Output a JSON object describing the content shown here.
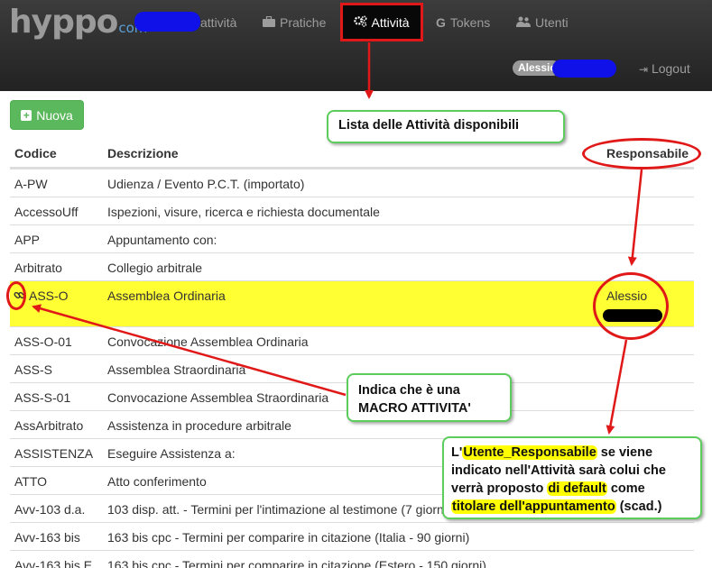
{
  "navbar": {
    "logo_main": "hyppo",
    "logo_suffix": "com",
    "items": [
      {
        "label": "attività",
        "icon": "none"
      },
      {
        "label": "Pratiche",
        "icon": "briefcase-icon"
      },
      {
        "label": "Attività",
        "icon": "gears-icon",
        "active": true
      },
      {
        "label": "Tokens",
        "icon": "google-icon"
      },
      {
        "label": "Utenti",
        "icon": "users-icon"
      }
    ],
    "user": "Alessio",
    "logout_label": "Logout"
  },
  "toolbar": {
    "new_label": "Nuova"
  },
  "table": {
    "headers": {
      "code": "Codice",
      "description": "Descrizione",
      "responsible": "Responsabile"
    },
    "rows": [
      {
        "code": "A-PW",
        "description": "Udienza / Evento P.C.T. (importato)",
        "responsible": ""
      },
      {
        "code": "AccessoUff",
        "description": "Ispezioni, visure, ricerca e richiesta documentale",
        "responsible": ""
      },
      {
        "code": "APP",
        "description": "Appuntamento con:",
        "responsible": ""
      },
      {
        "code": "Arbitrato",
        "description": "Collegio arbitrale",
        "responsible": ""
      },
      {
        "code": "ASS-O",
        "description": "Assemblea Ordinaria",
        "responsible": "Alessio",
        "macro": true,
        "highlighted": true
      },
      {
        "code": "ASS-O-01",
        "description": "Convocazione Assemblea Ordinaria",
        "responsible": ""
      },
      {
        "code": "ASS-S",
        "description": "Assemblea Straordinaria",
        "responsible": ""
      },
      {
        "code": "ASS-S-01",
        "description": "Convocazione Assemblea Straordinaria",
        "responsible": ""
      },
      {
        "code": "AssArbitrato",
        "description": "Assistenza in procedure arbitrale",
        "responsible": ""
      },
      {
        "code": "ASSISTENZA",
        "description": "Eseguire Assistenza a:",
        "responsible": ""
      },
      {
        "code": "ATTO",
        "description": "Atto conferimento",
        "responsible": ""
      },
      {
        "code": "Avv-103 d.a.",
        "description": "103 disp. att. - Termini per l'intimazione al testimone (7 giorni)",
        "responsible": ""
      },
      {
        "code": "Avv-163 bis",
        "description": "163 bis cpc - Termini per comparire in citazione (Italia - 90 giorni)",
        "responsible": ""
      },
      {
        "code": "Avv-163 bis E",
        "description": "163 bis cpc - Termini per comparire in citazione (Estero - 150 giorni)",
        "responsible": ""
      }
    ]
  },
  "annotations": {
    "list_note": "Lista delle Attività disponibili",
    "macro_note_line1": "Indica che è una",
    "macro_note_line2": "MACRO ATTIVITA'",
    "resp_note": {
      "p1": "L'",
      "p2": "Utente_Responsabile",
      "p3": " se viene indicato nell'Attività sarà colui che verrà proposto ",
      "p4": "di default",
      "p5": " come ",
      "p6": "titolare dell'appuntamento",
      "p7": " (scad.)"
    }
  },
  "colors": {
    "navbar": "#222222",
    "active_border": "#e01818",
    "button_green": "#5cb85c",
    "highlight_row": "#ffff33",
    "callout_border": "#5ccd5c",
    "redaction_blue": "#1010e8"
  }
}
